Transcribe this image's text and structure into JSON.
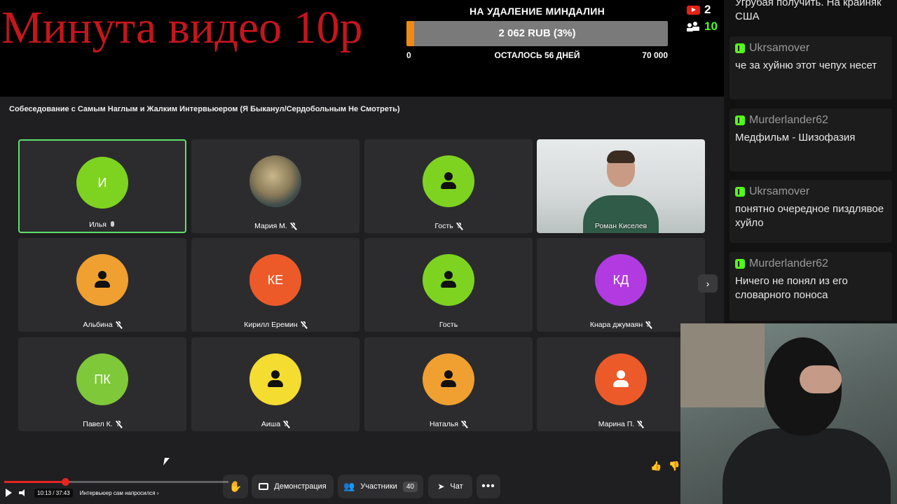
{
  "overlay": {
    "title": "Минута видео 10р",
    "donation_title": "НА УДАЛЕНИЕ МИНДАЛИН",
    "donation_amount": "2 062 RUB (3%)",
    "donation_progress": 0.03,
    "donation_min": "0",
    "donation_remaining": "ОСТАЛОСЬ 56 ДНЕЙ",
    "donation_max": "70 000",
    "viewers_youtube": "2",
    "viewers_kick": "10"
  },
  "meeting": {
    "title": "Собеседование с Самым Наглым и Жалким Интервьюером (Я Быканул/Сердобольным Не Смотреть)",
    "participants": [
      {
        "name": "Илья",
        "initials": "И",
        "color": "#7ed321",
        "mic": "on",
        "active": true,
        "kind": "initials"
      },
      {
        "name": "Мария М.",
        "initials": "",
        "color": "#5c6b66",
        "mic": "off",
        "active": false,
        "kind": "photo"
      },
      {
        "name": "Гость",
        "initials": "",
        "color": "#7ed321",
        "mic": "off",
        "active": false,
        "kind": "person"
      },
      {
        "name": "Роман Киселев",
        "initials": "",
        "color": "",
        "mic": "none",
        "active": false,
        "kind": "video"
      },
      {
        "name": "Альбина",
        "initials": "",
        "color": "#f0a030",
        "mic": "off",
        "active": false,
        "kind": "person"
      },
      {
        "name": "Кирилл Еремин",
        "initials": "КЕ",
        "color": "#ec5a2a",
        "mic": "off",
        "active": false,
        "kind": "initials"
      },
      {
        "name": "Гость",
        "initials": "",
        "color": "#7ed321",
        "mic": "none",
        "active": false,
        "kind": "person"
      },
      {
        "name": "Кнара джумаян",
        "initials": "КД",
        "color": "#b13be0",
        "mic": "off",
        "active": false,
        "kind": "initials"
      },
      {
        "name": "Павел К.",
        "initials": "ПК",
        "color": "#7ec83a",
        "mic": "off",
        "active": false,
        "kind": "initials"
      },
      {
        "name": "Аиша",
        "initials": "",
        "color": "#f5dc30",
        "mic": "off",
        "active": false,
        "kind": "person"
      },
      {
        "name": "Наталья",
        "initials": "",
        "color": "#f0a030",
        "mic": "off",
        "active": false,
        "kind": "person"
      },
      {
        "name": "Марина П.",
        "initials": "",
        "color": "#ec5a2a",
        "mic": "off",
        "active": false,
        "kind": "person-light"
      }
    ],
    "toolbar": {
      "demo_label": "Демонстрация",
      "participants_label": "Участники",
      "participants_count": "40",
      "chat_label": "Чат"
    }
  },
  "player": {
    "time": "10:13 / 37:43",
    "chapter": "Интервьюер сам напросился",
    "progress": 0.271
  },
  "chat": {
    "top_fragment": "Угрубая получить. На крайняк США",
    "messages": [
      {
        "user": "Ukrsamover",
        "text": "че за хуйню этот чепух несет"
      },
      {
        "user": "Murderlander62",
        "text": "Медфильм - Шизофазия"
      },
      {
        "user": "Ukrsamover",
        "text": "понятно очередное пиздлявое хуйло"
      },
      {
        "user": "Murderlander62",
        "text": "Ничего  не понял из его словарного поноса"
      }
    ]
  }
}
